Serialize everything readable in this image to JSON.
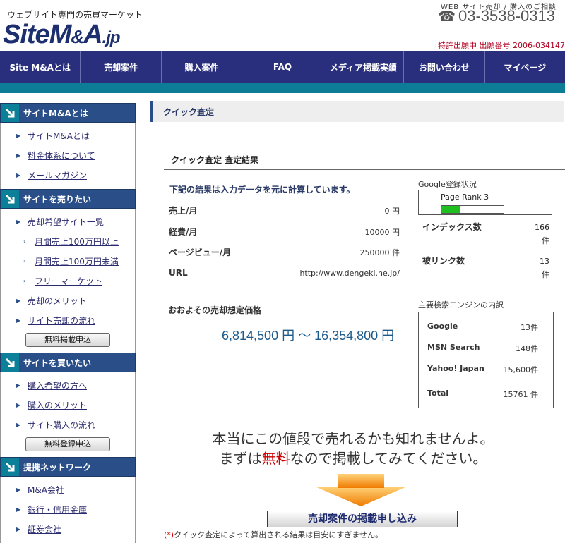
{
  "header": {
    "tagline": "ウェブサイト専門の売買マーケット",
    "logo": {
      "main": "SiteM",
      "amp": "&",
      "a": "A",
      "domain": ".jp"
    },
    "service_label": "WEB サイト売却 / 購入のご相談",
    "phone": "03-3538-0313",
    "patent": "特許出願中  出願番号  2006-034147"
  },
  "nav": [
    "Site M&Aとは",
    "売却案件",
    "購入案件",
    "FAQ",
    "メディア掲載実績",
    "お問い合わせ",
    "マイページ"
  ],
  "sidebar": {
    "sections": [
      {
        "title": "サイトM&Aとは",
        "items": [
          {
            "label": "サイトM&Aとは"
          },
          {
            "label": "料金体系について"
          },
          {
            "label": "メールマガジン"
          }
        ]
      },
      {
        "title": "サイトを売りたい",
        "items": [
          {
            "label": "売却希望サイト一覧"
          },
          {
            "label": "月間売上100万円以上",
            "sub": true
          },
          {
            "label": "月間売上100万円未満",
            "sub": true
          },
          {
            "label": "フリーマーケット",
            "sub": true
          },
          {
            "label": "売却のメリット"
          },
          {
            "label": "サイト売却の流れ"
          }
        ],
        "button": "無料掲載申込"
      },
      {
        "title": "サイトを買いたい",
        "items": [
          {
            "label": "購入希望の方へ"
          },
          {
            "label": "購入のメリット"
          },
          {
            "label": "サイト購入の流れ"
          }
        ],
        "button": "無料登録申込"
      },
      {
        "title": "提携ネットワーク",
        "items": [
          {
            "label": "M&A会社"
          },
          {
            "label": "銀行・信用金庫"
          },
          {
            "label": "証券会社"
          }
        ]
      }
    ]
  },
  "main": {
    "page_title": "クイック査定",
    "result_head": "クイック査定  査定結果",
    "calc_note": "下記の結果は入力データを元に計算しています。",
    "rows": [
      {
        "label": "売上/月",
        "value": "0 円"
      },
      {
        "label": "経費/月",
        "value": "10000 円"
      },
      {
        "label": "ページビュー/月",
        "value": "250000 件"
      },
      {
        "label": "URL",
        "value": "http://www.dengeki.ne.jp/"
      }
    ],
    "estimate_label": "おおよその売却想定価格",
    "estimate_range": "6,814,500 円 〜 16,354,800 円"
  },
  "google": {
    "status_label": "Google登録状況",
    "page_rank_label": "Page Rank 3",
    "page_rank": 3,
    "page_rank_max": 10,
    "index_label": "インデックス数",
    "index_value": "166",
    "index_unit": "件",
    "backlink_label": "被リンク数",
    "backlink_value": "13",
    "backlink_unit": "件"
  },
  "engines": {
    "head": "主要検索エンジンの内訳",
    "rows": [
      {
        "name": "Google",
        "value": "13件"
      },
      {
        "name": "MSN Search",
        "value": "148件"
      },
      {
        "name": "Yahoo!  Japan",
        "value": "15,600件"
      },
      {
        "name": "Total",
        "value": "15761 件"
      }
    ]
  },
  "promo": {
    "line1": "本当にこの値段で売れるかも知れませんよ。",
    "line2_pre": "まずは",
    "line2_red": "無料",
    "line2_post": "なので掲載してみてください。",
    "cta": "売却案件の掲載申し込み",
    "footnote_mark": "(*)",
    "footnote": "クイック査定によって算出される結果は目安にすぎません。"
  },
  "colors": {
    "nav": "#2a2f7d",
    "teal": "#0d7d97",
    "sidebar_head": "#2a4f88",
    "accent_red": "#c00000",
    "price": "#1d5a8a"
  }
}
